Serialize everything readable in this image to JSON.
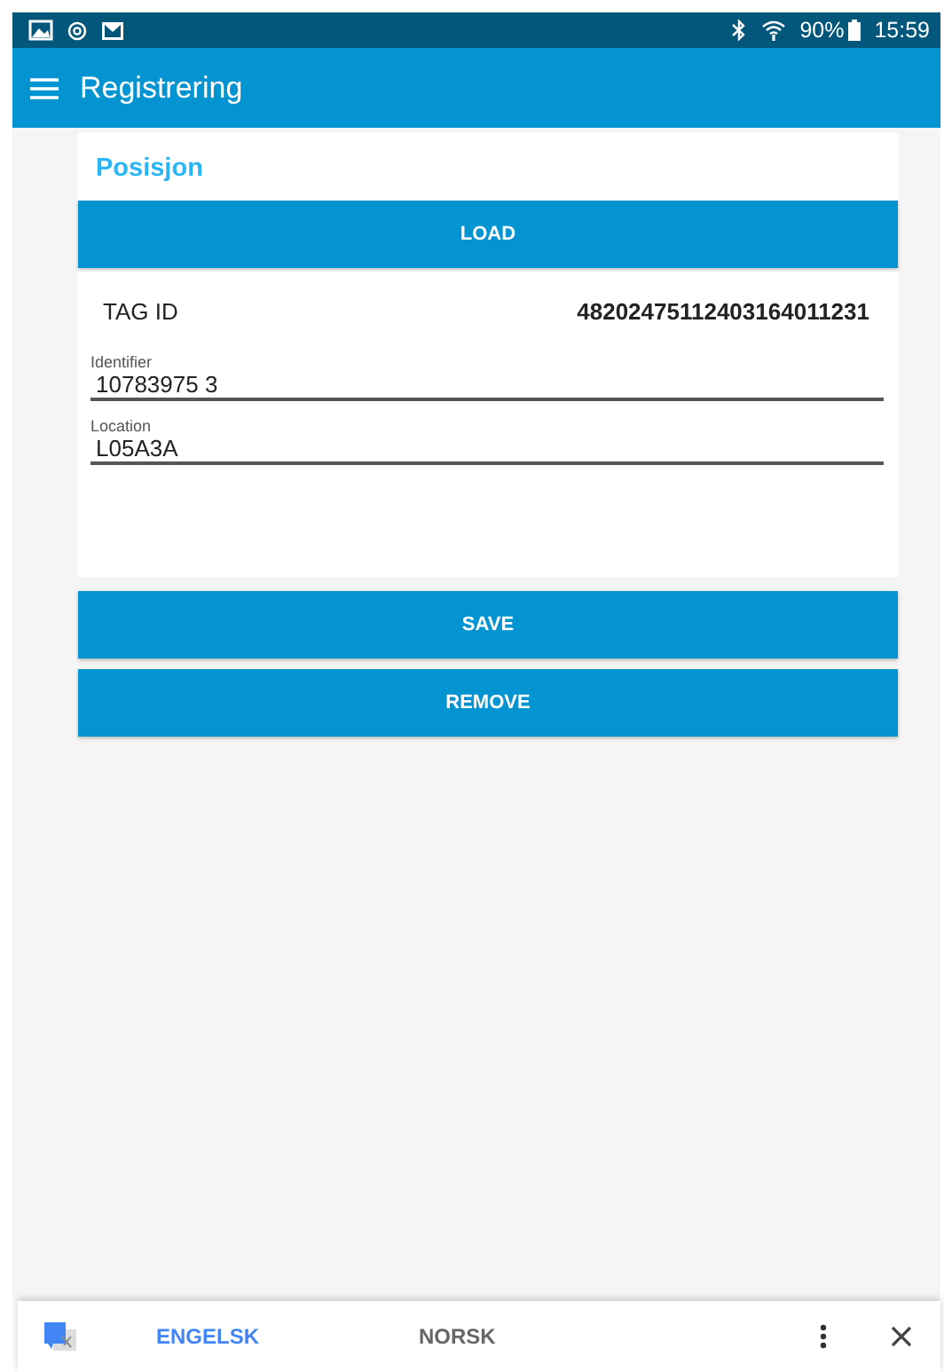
{
  "status_bar": {
    "battery": "90%",
    "time": "15:59"
  },
  "app_bar": {
    "title": "Registrering"
  },
  "card": {
    "title": "Posisjon",
    "load_button": "LOAD",
    "tag_label": "TAG ID",
    "tag_value": "48202475112403164011231",
    "fields": [
      {
        "label": "Identifier",
        "value": "10783975 3"
      },
      {
        "label": "Location",
        "value": "L05A3A"
      }
    ]
  },
  "buttons": [
    "SAVE",
    "REMOVE"
  ],
  "translate_bar": {
    "languages": [
      {
        "label": "ENGELSK",
        "selected": true
      },
      {
        "label": "NORSK",
        "selected": false
      }
    ]
  }
}
